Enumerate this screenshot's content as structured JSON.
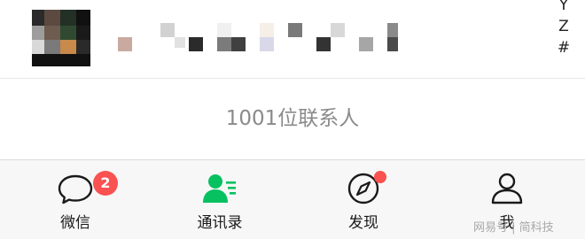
{
  "contact_list": {
    "row": {
      "avatar_icon": "pixelated-avatar",
      "name": "blurred-contact-name"
    },
    "index_letters": [
      "Y",
      "Z",
      "#"
    ],
    "contact_count": "1001位联系人"
  },
  "tabbar": {
    "tabs": [
      {
        "label": "微信",
        "icon": "chat-bubble-icon",
        "badge": "2",
        "active": false
      },
      {
        "label": "通讯录",
        "icon": "contacts-icon",
        "active": true
      },
      {
        "label": "发现",
        "icon": "compass-icon",
        "has_dot": true,
        "active": false
      },
      {
        "label": "我",
        "icon": "person-icon",
        "active": false
      }
    ]
  },
  "colors": {
    "active_green": "#07c160",
    "badge_red": "#fa5151",
    "muted_text": "#8a8a8a",
    "tabbar_bg": "#f7f7f7"
  },
  "watermark": {
    "text": "网易号 | 简科技"
  }
}
